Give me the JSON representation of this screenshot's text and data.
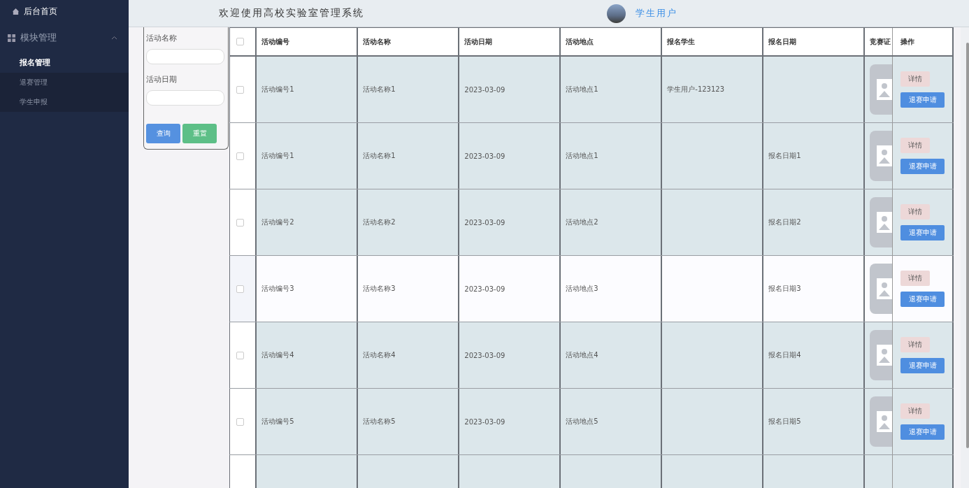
{
  "sidebar": {
    "home": {
      "label": "后台首页",
      "selected": false
    },
    "groups": [
      {
        "label": "模块管理",
        "expanded": true,
        "children": [
          {
            "label": "报名管理",
            "selected": true
          },
          {
            "label": "退赛管理",
            "selected": false
          },
          {
            "label": "学生申报",
            "selected": false
          }
        ]
      }
    ]
  },
  "header": {
    "title": "欢迎使用高校实验室管理系统",
    "user": "学生用户"
  },
  "search": {
    "fields": [
      {
        "label": "活动名称"
      },
      {
        "label": "活动日期"
      }
    ],
    "buttons": [
      {
        "label": "查询",
        "kind": "primary"
      },
      {
        "label": "重置",
        "kind": "success"
      }
    ]
  },
  "table": {
    "select_all_checked": false,
    "columns": [
      "活动编号",
      "活动名称",
      "活动日期",
      "活动地点",
      "报名学生",
      "报名日期",
      "竞赛证",
      "操作"
    ],
    "rows": [
      {
        "checked": false,
        "highlighted": false,
        "code": "活动编号1",
        "name": "活动名称1",
        "date": "2023-03-09",
        "place": "活动地点1",
        "student": "学生用户-123123",
        "actions": [
          "详情",
          "退赛申请"
        ]
      },
      {
        "checked": false,
        "highlighted": false,
        "code": "活动编号1",
        "name": "活动名称1",
        "date": "2023-03-09",
        "place": "活动地点1",
        "signup_date": "报名日期1",
        "actions": [
          "详情",
          "退赛申请"
        ]
      },
      {
        "checked": false,
        "highlighted": false,
        "code": "活动编号2",
        "name": "活动名称2",
        "date": "2023-03-09",
        "place": "活动地点2",
        "signup_date": "报名日期2",
        "actions": [
          "详情",
          "退赛申请"
        ]
      },
      {
        "checked": false,
        "highlighted": true,
        "code": "活动编号3",
        "name": "活动名称3",
        "date": "2023-03-09",
        "place": "活动地点3",
        "signup_date": "报名日期3",
        "actions": [
          "详情",
          "退赛申请"
        ]
      },
      {
        "checked": false,
        "highlighted": false,
        "code": "活动编号4",
        "name": "活动名称4",
        "date": "2023-03-09",
        "place": "活动地点4",
        "signup_date": "报名日期4",
        "actions": [
          "详情",
          "退赛申请"
        ]
      },
      {
        "checked": false,
        "highlighted": false,
        "code": "活动编号5",
        "name": "活动名称5",
        "date": "2023-03-09",
        "place": "活动地点5",
        "signup_date": "报名日期5",
        "actions": [
          "详情",
          "退赛申请"
        ]
      }
    ]
  }
}
